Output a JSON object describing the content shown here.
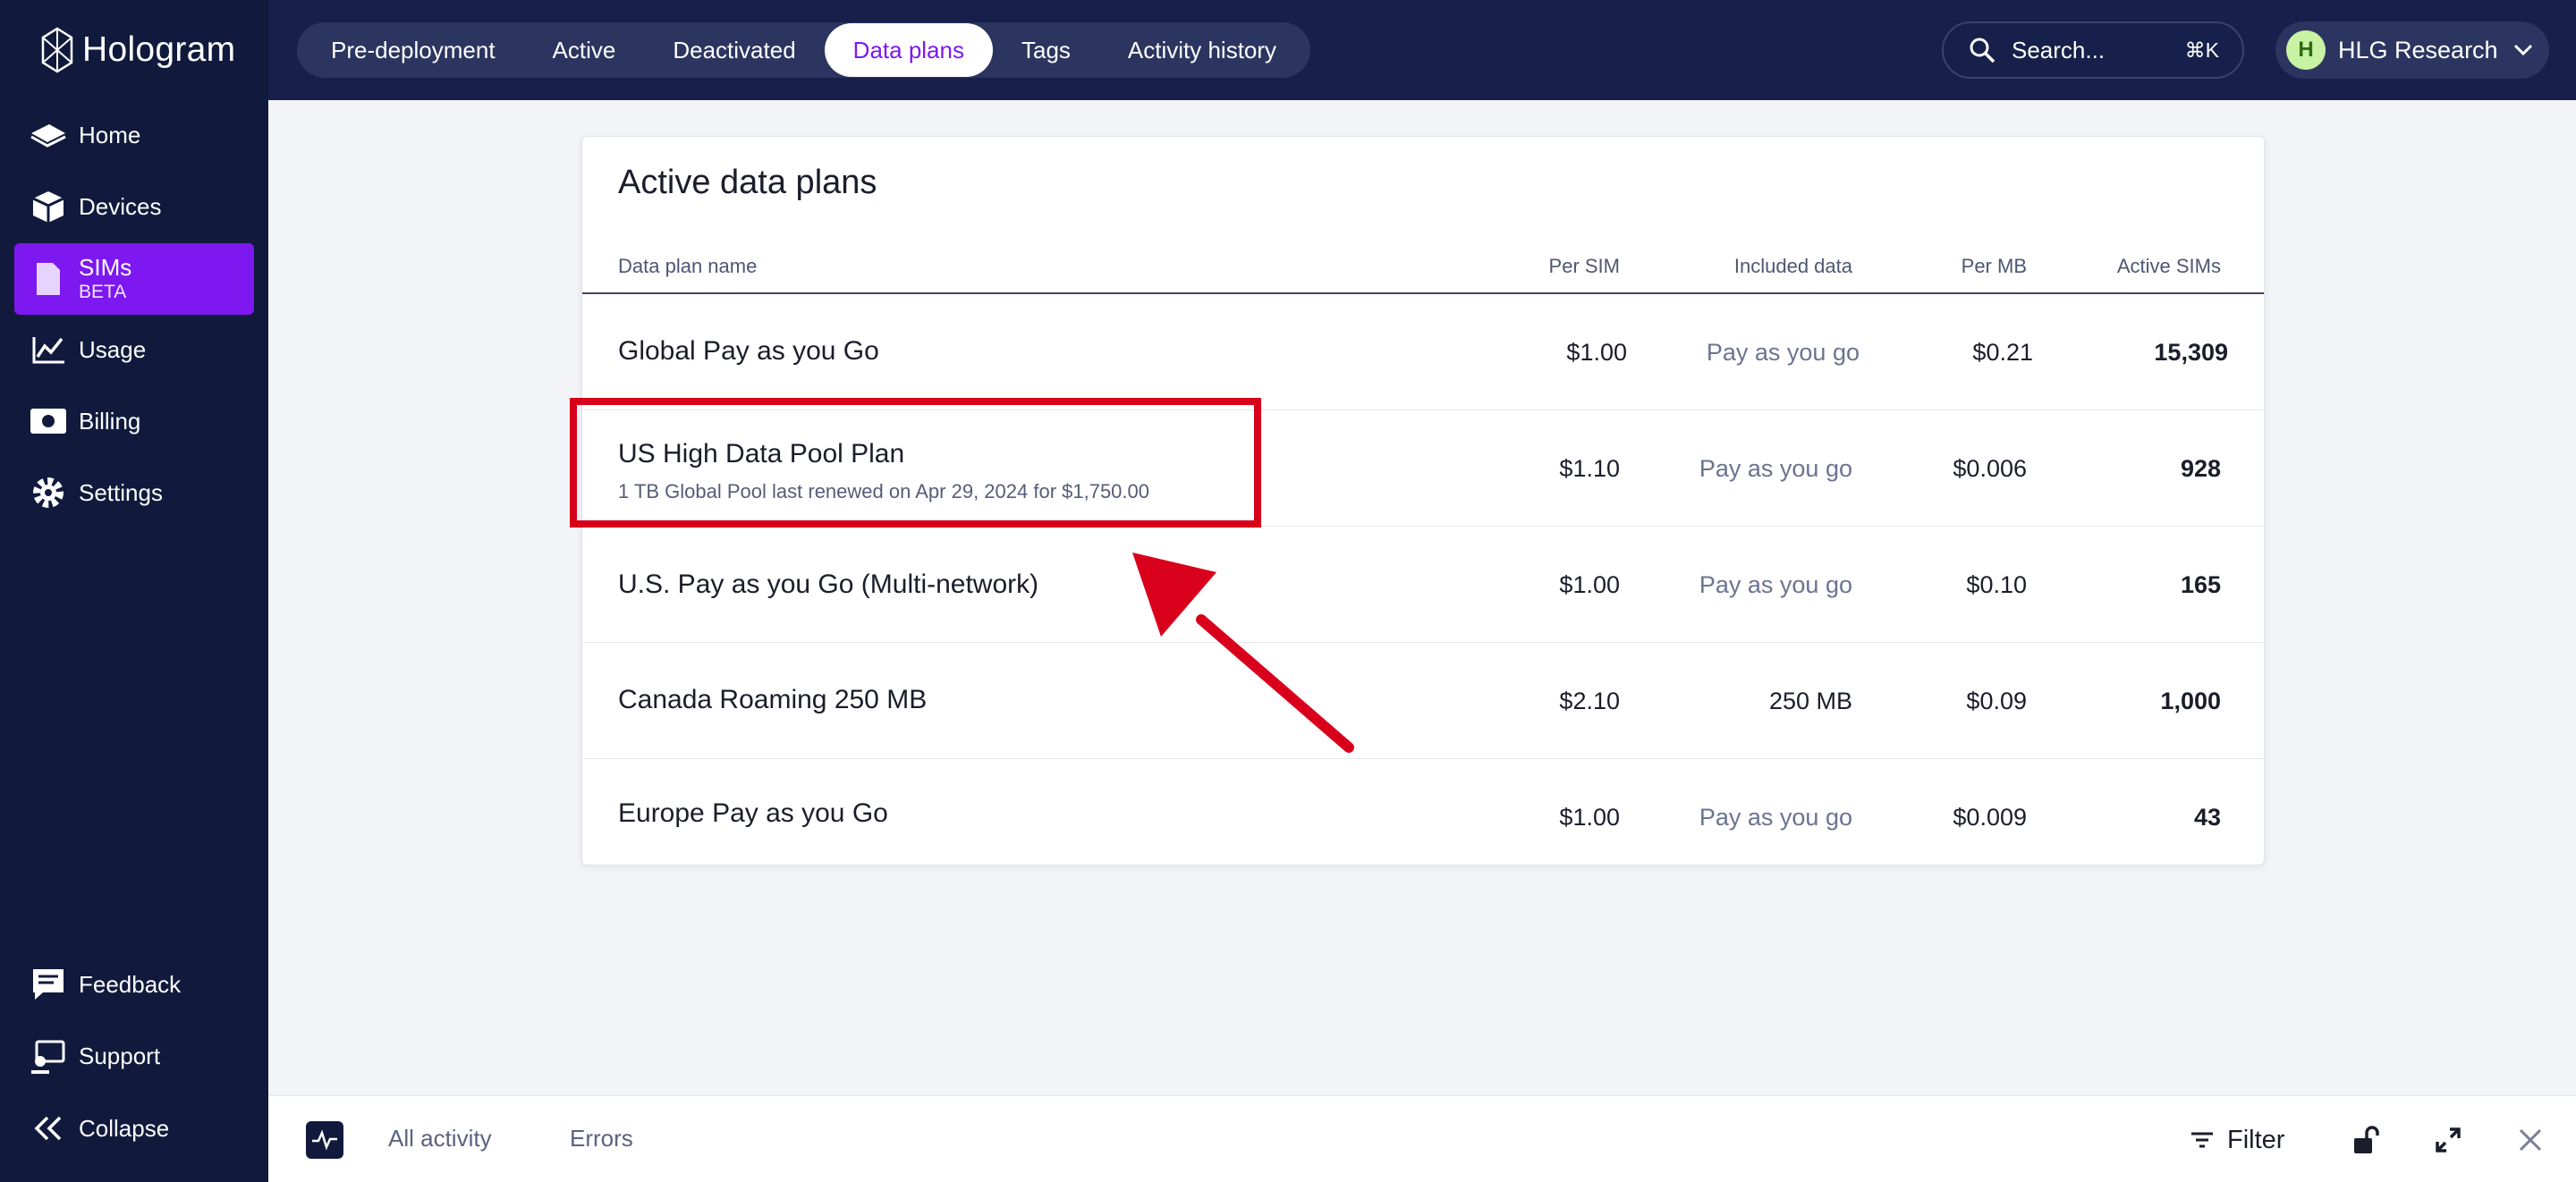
{
  "brand": {
    "name": "Hologram"
  },
  "sidebar": {
    "items": [
      {
        "label": "Home",
        "icon": "home-icon"
      },
      {
        "label": "Devices",
        "icon": "devices-icon"
      },
      {
        "label": "SIMs",
        "sub": "BETA",
        "icon": "sim-icon",
        "active": true
      },
      {
        "label": "Usage",
        "icon": "usage-icon"
      },
      {
        "label": "Billing",
        "icon": "billing-icon"
      },
      {
        "label": "Settings",
        "icon": "gear-icon"
      }
    ],
    "bottom": [
      {
        "label": "Feedback",
        "icon": "feedback-icon"
      },
      {
        "label": "Support",
        "icon": "support-icon"
      },
      {
        "label": "Collapse",
        "icon": "collapse-icon"
      }
    ]
  },
  "topbar": {
    "tabs": [
      "Pre-deployment",
      "Active",
      "Deactivated",
      "Data plans",
      "Tags",
      "Activity history"
    ],
    "active_tab": "Data plans",
    "search": {
      "placeholder": "Search...",
      "shortcut": "⌘K"
    },
    "account": {
      "initial": "H",
      "name": "HLG Research"
    }
  },
  "card": {
    "title": "Active data plans",
    "columns": [
      "Data plan name",
      "Per SIM",
      "Included data",
      "Per MB",
      "Active SIMs"
    ],
    "rows": [
      {
        "name": "Global Pay as you Go",
        "sub": "",
        "per_sim": "$1.00",
        "included": "Pay as you go",
        "per_mb": "$0.21",
        "active_sims": "15,309"
      },
      {
        "name": "US High Data Pool Plan",
        "sub": "1 TB Global Pool last renewed on Apr 29, 2024 for $1,750.00",
        "per_sim": "$1.10",
        "included": "Pay as you go",
        "per_mb": "$0.006",
        "active_sims": "928"
      },
      {
        "name": "U.S. Pay as you Go (Multi-network)",
        "sub": "",
        "per_sim": "$1.00",
        "included": "Pay as you go",
        "per_mb": "$0.10",
        "active_sims": "165"
      },
      {
        "name": "Canada Roaming 250 MB",
        "sub": "",
        "per_sim": "$2.10",
        "included": "250 MB",
        "per_mb": "$0.09",
        "active_sims": "1,000"
      },
      {
        "name": "Europe Pay as you Go",
        "sub": "",
        "per_sim": "$1.00",
        "included": "Pay as you go",
        "per_mb": "$0.009",
        "active_sims": "43"
      }
    ]
  },
  "bottombar": {
    "tabs": [
      "All activity",
      "Errors"
    ],
    "filter_label": "Filter"
  },
  "colors": {
    "sidebar_bg": "#111a3d",
    "topbar_bg": "#16204a",
    "accent": "#7d18f0",
    "annotation": "#d9001b"
  }
}
